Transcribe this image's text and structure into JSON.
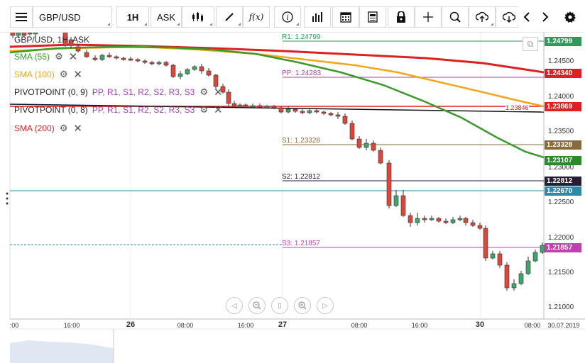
{
  "toolbar": {
    "symbol": "GBP/USD",
    "timeframe": "1H",
    "price_type": "ASK",
    "icons": [
      "menu-icon",
      "candles-icon",
      "draw-icon",
      "function-icon",
      "info-icon",
      "bar-chart-icon",
      "calendar-icon",
      "news-icon",
      "lock-icon",
      "crosshair-icon",
      "zoom-icon",
      "upload-icon",
      "download-icon",
      "prev-icon",
      "next-icon",
      "settings-icon"
    ],
    "function_label": "f(x)"
  },
  "legend": {
    "instrument": "GBP/USD, 1H, ASK",
    "items": [
      {
        "label": "SMA (55)",
        "color": "#3a9a2a"
      },
      {
        "label": "SMA (100)",
        "color": "#f2a51d"
      },
      {
        "label": "PIVOTPOINT (0, 9)",
        "color": "#222222",
        "suffix": "PP, R1, S1, R2, S2, R3, S3"
      },
      {
        "label": "PIVOTPOINT (0, 8)",
        "color": "#222222",
        "suffix": "PP, R1, S1, R2, S2, R3, S3"
      },
      {
        "label": "SMA (200)",
        "color": "#e02020"
      }
    ]
  },
  "pivots": {
    "r1": "R1: 1.24799",
    "pp": "PP: 1.24283",
    "s1": "S1: 1.23328",
    "s2": "S2: 1.22812",
    "s3": "S3: 1.21857"
  },
  "price_tags": [
    {
      "value": "1.24799",
      "color": "#2e9a5a"
    },
    {
      "value": "1.24340",
      "color": "#e02020"
    },
    {
      "value": "1.23869",
      "color": "#e02020"
    },
    {
      "value": "1.23328",
      "color": "#8a6a3a"
    },
    {
      "value": "1.23107",
      "color": "#2a8a2a"
    },
    {
      "value": "1.22812",
      "color": "#2a1a3a"
    },
    {
      "value": "1.22670",
      "color": "#2a8aa8"
    },
    {
      "value": "1.21857",
      "color": "#c040b0"
    }
  ],
  "inline_price": "1.23846",
  "axis": {
    "price_labels": [
      "1.24500",
      "1.24000",
      "1.23500",
      "1.23000",
      "1.22500",
      "1.22000",
      "1.21500",
      "1.21000"
    ],
    "time_labels": [
      ":00",
      "16:00",
      "26",
      "08:00",
      "16:00",
      "27",
      "08:00",
      "16:00",
      "30",
      "08:00",
      "30.07.2019"
    ]
  },
  "colors": {
    "sma55": "#3a9a2a",
    "sma100": "#f2a51d",
    "sma200": "#e02020",
    "bull": "#3fa56a",
    "bear": "#d9483b"
  }
}
